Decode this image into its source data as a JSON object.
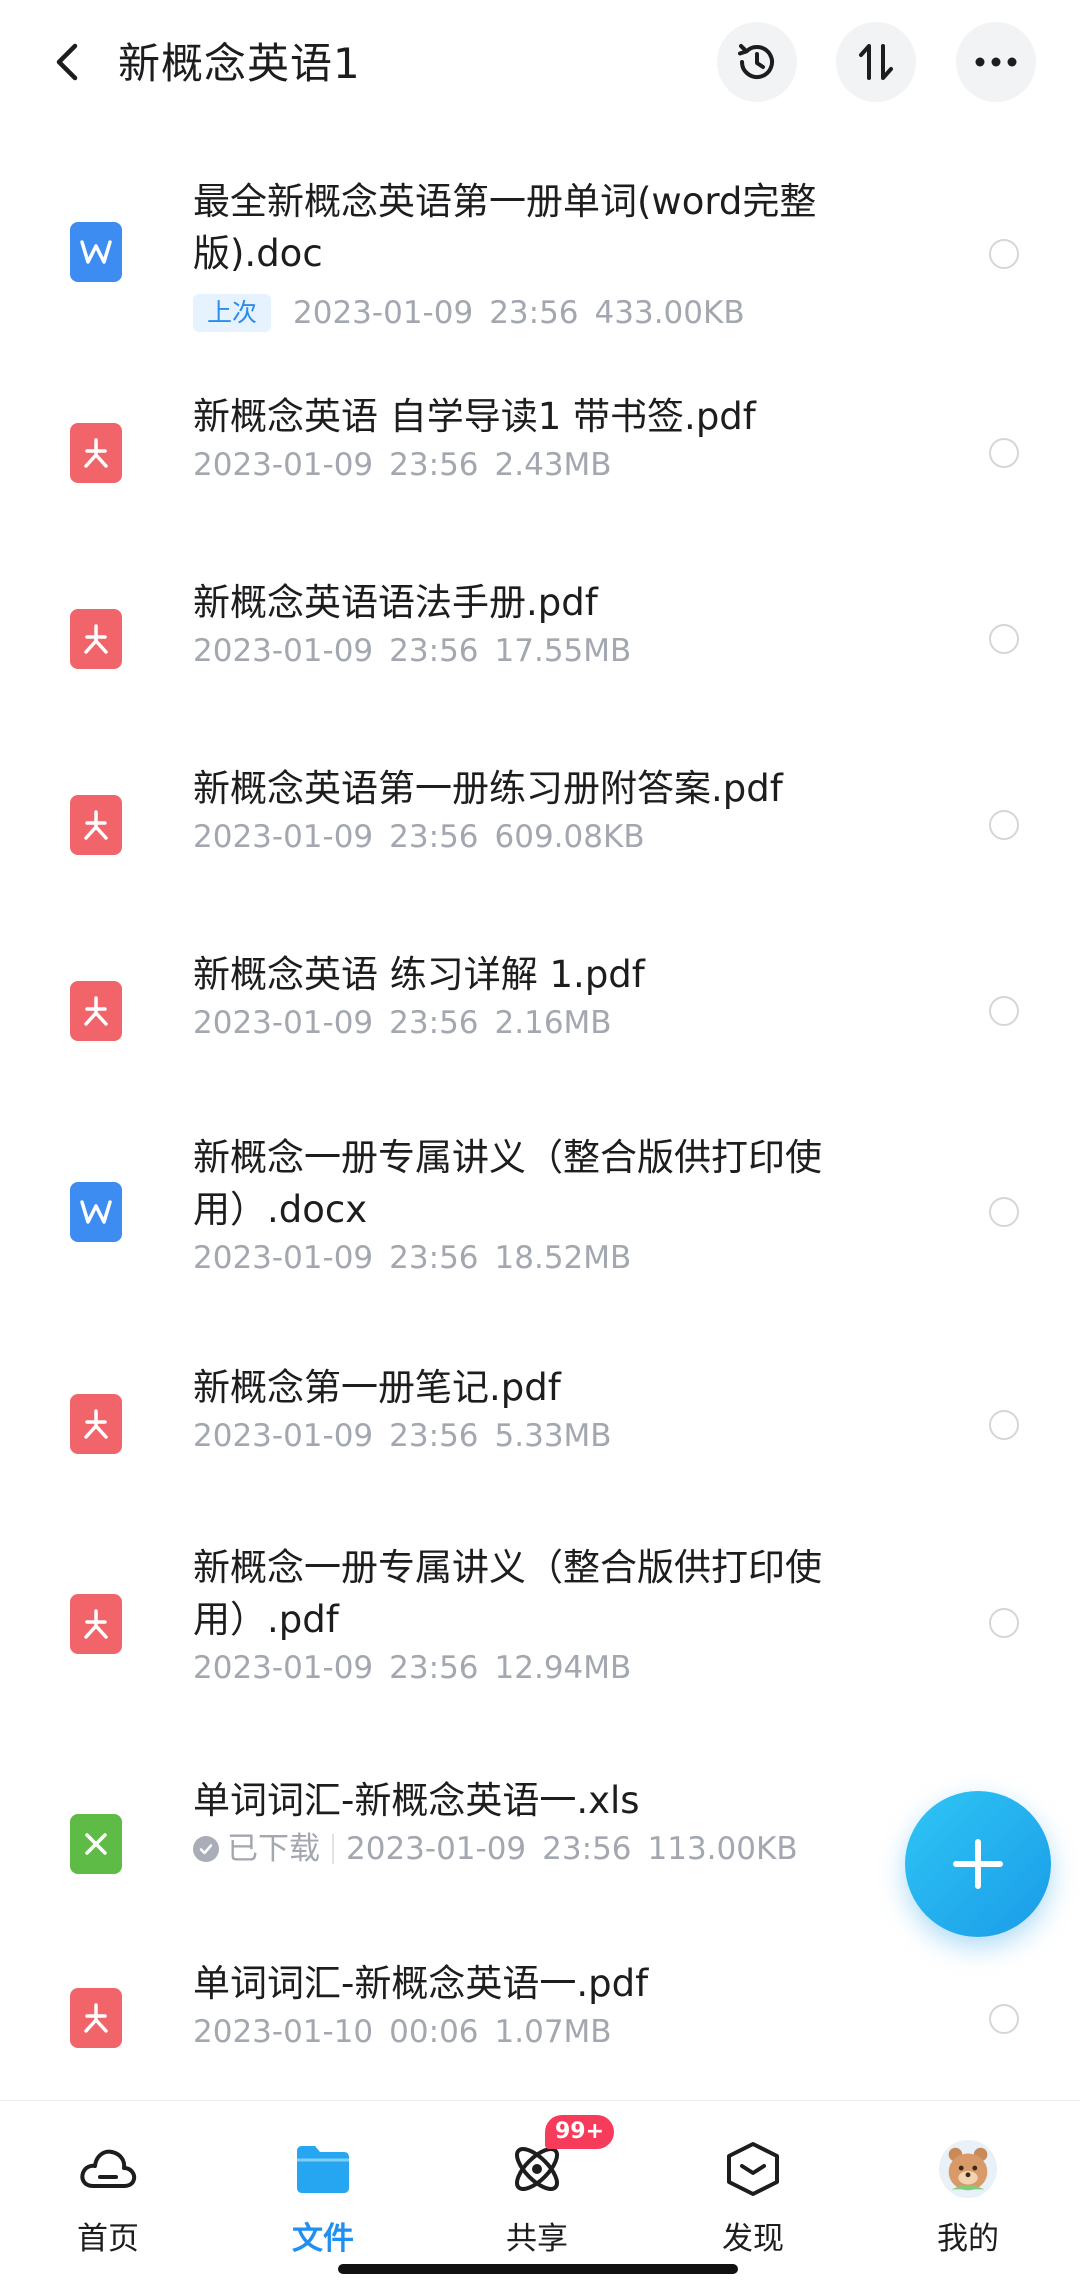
{
  "header": {
    "title": "新概念英语1",
    "icons": [
      "back-icon",
      "history-icon",
      "sort-icon",
      "more-icon"
    ]
  },
  "files": [
    {
      "type": "word",
      "name": "最全新概念英语第一册单词(word完整版).doc",
      "tag": "上次",
      "date": "2023-01-09",
      "time": "23:56",
      "size": "433.00KB"
    },
    {
      "type": "pdf",
      "name": "新概念英语 自学导读1 带书签.pdf",
      "date": "2023-01-09",
      "time": "23:56",
      "size": "2.43MB"
    },
    {
      "type": "pdf",
      "name": "新概念英语语法手册.pdf",
      "date": "2023-01-09",
      "time": "23:56",
      "size": "17.55MB"
    },
    {
      "type": "pdf",
      "name": "新概念英语第一册练习册附答案.pdf",
      "date": "2023-01-09",
      "time": "23:56",
      "size": "609.08KB"
    },
    {
      "type": "pdf",
      "name": "新概念英语 练习详解 1.pdf",
      "date": "2023-01-09",
      "time": "23:56",
      "size": "2.16MB"
    },
    {
      "type": "word",
      "name": "新概念一册专属讲义（整合版供打印使用）.docx",
      "date": "2023-01-09",
      "time": "23:56",
      "size": "18.52MB"
    },
    {
      "type": "pdf",
      "name": "新概念第一册笔记.pdf",
      "date": "2023-01-09",
      "time": "23:56",
      "size": "5.33MB"
    },
    {
      "type": "pdf",
      "name": "新概念一册专属讲义（整合版供打印使用）.pdf",
      "date": "2023-01-09",
      "time": "23:56",
      "size": "12.94MB"
    },
    {
      "type": "xls",
      "name": "单词词汇-新概念英语一.xls",
      "status": "已下载",
      "date": "2023-01-09",
      "time": "23:56",
      "size": "113.00KB"
    },
    {
      "type": "pdf",
      "name": "单词词汇-新概念英语一.pdf",
      "date": "2023-01-10",
      "time": "00:06",
      "size": "1.07MB"
    }
  ],
  "fab": {
    "icon": "plus-icon"
  },
  "nav": {
    "items": [
      {
        "label": "首页",
        "icon": "cloud-icon"
      },
      {
        "label": "文件",
        "icon": "folder-icon",
        "active": true
      },
      {
        "label": "共享",
        "icon": "share-planet-icon",
        "badge": "99+"
      },
      {
        "label": "发现",
        "icon": "discover-cube-icon"
      },
      {
        "label": "我的",
        "icon": "avatar-icon"
      }
    ]
  },
  "colors": {
    "accent": "#1f8ff0",
    "word": "#3d8cf2",
    "pdf": "#f0646a",
    "xls": "#5dbb46",
    "badge": "#f73b5a"
  }
}
